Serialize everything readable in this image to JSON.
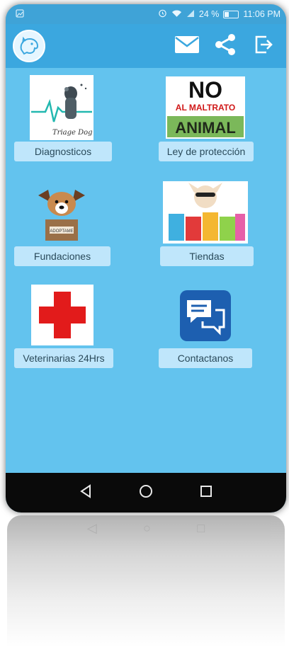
{
  "status_bar": {
    "left_icon": "image-icon",
    "icons": [
      "alarm-icon",
      "wifi-icon",
      "signal-icon"
    ],
    "battery": "24 %",
    "time": "11:06 PM"
  },
  "app_bar": {
    "logo_icon": "dog-logo-icon",
    "actions": [
      "mail-icon",
      "share-icon",
      "exit-icon"
    ]
  },
  "tiles": [
    {
      "label": "Diagnosticos",
      "icon": "dog-heartbeat-image",
      "image_text": "Triage Dog"
    },
    {
      "label": "Ley de protección",
      "icon": "no-maltrato-image",
      "image_text_top": "NO",
      "image_text_mid": "AL MALTRATO",
      "image_text_bottom": "ANIMAL"
    },
    {
      "label": "Fundaciones",
      "icon": "dog-box-image",
      "image_text": "ADOPTAME"
    },
    {
      "label": "Tiendas",
      "icon": "dog-shopping-image"
    },
    {
      "label": "Veterinarias 24Hrs",
      "icon": "red-cross-image"
    },
    {
      "label": "Contactanos",
      "icon": "chat-bubbles-image"
    }
  ],
  "nav_bar": {
    "buttons": [
      "back-icon",
      "home-icon",
      "recents-icon"
    ]
  },
  "colors": {
    "status_bar": "#3fa3d7",
    "app_bar": "#3ba7df",
    "content_bg": "#63c3ee",
    "label_bg": "#bfe6fb",
    "red_cross": "#e21b1b",
    "chat_blue": "#1d5fb0"
  }
}
